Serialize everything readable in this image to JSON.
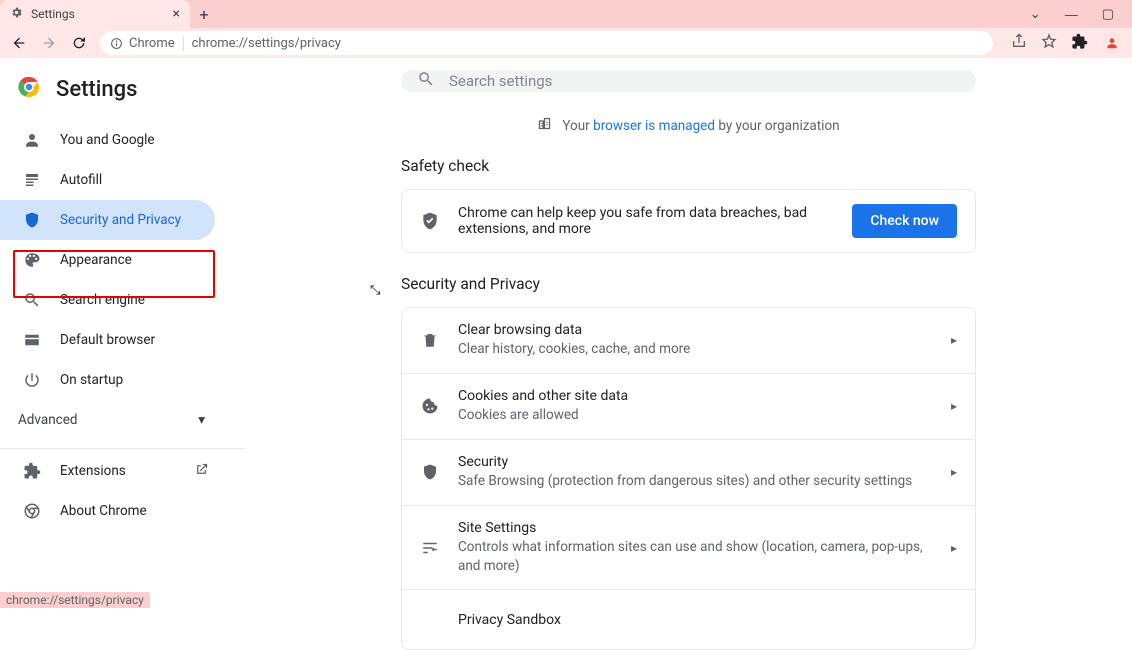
{
  "window": {
    "tab_title": "Settings",
    "dropdown": "⌄",
    "minimize": "—",
    "maximize": "▢"
  },
  "toolbar": {
    "secure_label": "Chrome",
    "url": "chrome://settings/privacy"
  },
  "brand": "Settings",
  "search": {
    "placeholder": "Search settings"
  },
  "managed": {
    "prefix": "Your ",
    "link": "browser is managed",
    "suffix": " by your organization"
  },
  "sidebar": {
    "items": [
      {
        "label": "You and Google"
      },
      {
        "label": "Autofill"
      },
      {
        "label": "Security and Privacy"
      },
      {
        "label": "Appearance"
      },
      {
        "label": "Search engine"
      },
      {
        "label": "Default browser"
      },
      {
        "label": "On startup"
      }
    ],
    "advanced": "Advanced",
    "extensions": "Extensions",
    "about": "About Chrome"
  },
  "safety": {
    "heading": "Safety check",
    "text": "Chrome can help keep you safe from data breaches, bad extensions, and more",
    "button": "Check now"
  },
  "sp": {
    "heading": "Security and Privacy",
    "rows": [
      {
        "title": "Clear browsing data",
        "sub": "Clear history, cookies, cache, and more"
      },
      {
        "title": "Cookies and other site data",
        "sub": "Cookies are allowed"
      },
      {
        "title": "Security",
        "sub": "Safe Browsing (protection from dangerous sites) and other security settings"
      },
      {
        "title": "Site Settings",
        "sub": "Controls what information sites can use and show (location, camera, pop-ups, and more)"
      },
      {
        "title": "Privacy Sandbox",
        "sub": ""
      }
    ]
  },
  "status_url": "chrome://settings/privacy"
}
